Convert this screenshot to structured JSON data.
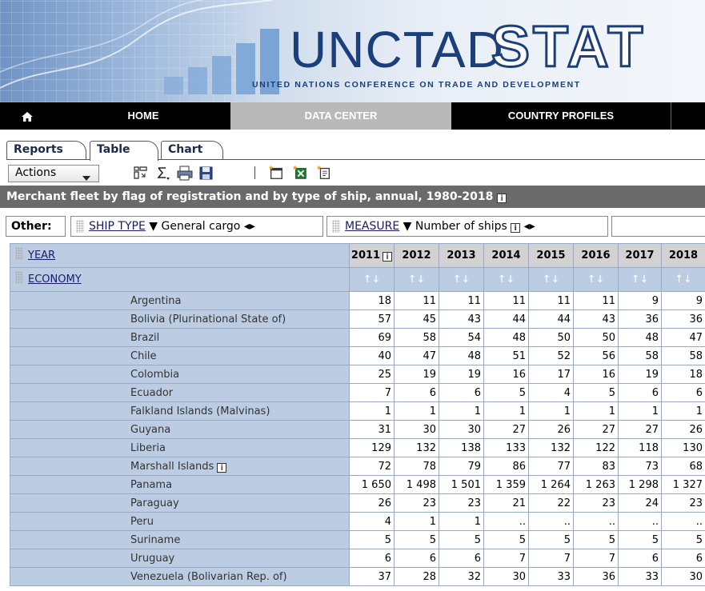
{
  "banner": {
    "logo_main": "UNCTAD",
    "logo_accent": "STAT",
    "subtitle": "UNITED NATIONS CONFERENCE ON TRADE AND DEVELOPMENT",
    "colors": {
      "brand": "#1a3f7a",
      "accent_bar": "#7aa5d6"
    }
  },
  "nav": {
    "home_icon": "home-icon",
    "items": [
      "HOME",
      "DATA CENTER",
      "COUNTRY PROFILES"
    ]
  },
  "tabs": [
    "Reports",
    "Table",
    "Chart"
  ],
  "toolbar": {
    "actions_label": "Actions",
    "icons": [
      "pivot-icon",
      "sum-icon",
      "print-icon",
      "save-icon",
      "new-window-icon",
      "excel-icon",
      "export-icon"
    ]
  },
  "title": "Merchant fleet by flag of registration and by type of ship, annual, 1980-2018",
  "filters": {
    "other_label": "Other:",
    "ship_type_label": "SHIP TYPE",
    "ship_type_value": "General cargo",
    "measure_label": "MEASURE",
    "measure_value": "Number of ships"
  },
  "table": {
    "row_dim_year": "YEAR",
    "row_dim_economy": "ECONOMY",
    "years": [
      "2011",
      "2012",
      "2013",
      "2014",
      "2015",
      "2016",
      "2017",
      "2018"
    ],
    "sort_symbol": "↑↓",
    "rows": [
      {
        "name": "Argentina",
        "values": [
          "18",
          "11",
          "11",
          "11",
          "11",
          "11",
          "9",
          "9"
        ]
      },
      {
        "name": "Bolivia (Plurinational State of)",
        "values": [
          "57",
          "45",
          "43",
          "44",
          "44",
          "43",
          "36",
          "36"
        ]
      },
      {
        "name": "Brazil",
        "values": [
          "69",
          "58",
          "54",
          "48",
          "50",
          "50",
          "48",
          "47"
        ]
      },
      {
        "name": "Chile",
        "values": [
          "40",
          "47",
          "48",
          "51",
          "52",
          "56",
          "58",
          "58"
        ]
      },
      {
        "name": "Colombia",
        "values": [
          "25",
          "19",
          "19",
          "16",
          "17",
          "16",
          "19",
          "18"
        ]
      },
      {
        "name": "Ecuador",
        "values": [
          "7",
          "6",
          "6",
          "5",
          "4",
          "5",
          "6",
          "6"
        ]
      },
      {
        "name": "Falkland Islands (Malvinas)",
        "values": [
          "1",
          "1",
          "1",
          "1",
          "1",
          "1",
          "1",
          "1"
        ]
      },
      {
        "name": "Guyana",
        "values": [
          "31",
          "30",
          "30",
          "27",
          "26",
          "27",
          "27",
          "26"
        ]
      },
      {
        "name": "Liberia",
        "values": [
          "129",
          "132",
          "138",
          "133",
          "132",
          "122",
          "118",
          "130"
        ]
      },
      {
        "name": "Marshall Islands",
        "info": true,
        "values": [
          "72",
          "78",
          "79",
          "86",
          "77",
          "83",
          "73",
          "68"
        ]
      },
      {
        "name": "Panama",
        "values": [
          "1 650",
          "1 498",
          "1 501",
          "1 359",
          "1 264",
          "1 263",
          "1 298",
          "1 327"
        ]
      },
      {
        "name": "Paraguay",
        "values": [
          "26",
          "23",
          "23",
          "21",
          "22",
          "23",
          "24",
          "23"
        ]
      },
      {
        "name": "Peru",
        "values": [
          "4",
          "1",
          "1",
          "..",
          "..",
          "..",
          "..",
          ".."
        ]
      },
      {
        "name": "Suriname",
        "values": [
          "5",
          "5",
          "5",
          "5",
          "5",
          "5",
          "5",
          "5"
        ]
      },
      {
        "name": "Uruguay",
        "values": [
          "6",
          "6",
          "6",
          "7",
          "7",
          "7",
          "6",
          "6"
        ]
      },
      {
        "name": "Venezuela (Bolivarian Rep. of)",
        "values": [
          "37",
          "28",
          "32",
          "30",
          "33",
          "36",
          "33",
          "30"
        ]
      }
    ]
  }
}
